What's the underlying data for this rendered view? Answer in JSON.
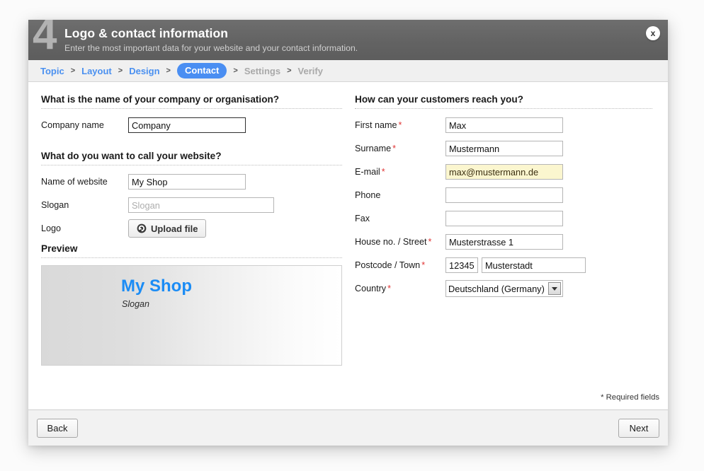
{
  "header": {
    "step": "4",
    "title": "Logo & contact information",
    "subtitle": "Enter the most important data for your website and your contact information.",
    "close_label": "x"
  },
  "breadcrumb": {
    "separator": ">",
    "items": [
      {
        "label": "Topic",
        "state": "link"
      },
      {
        "label": "Layout",
        "state": "link"
      },
      {
        "label": "Design",
        "state": "link"
      },
      {
        "label": "Contact",
        "state": "active"
      },
      {
        "label": "Settings",
        "state": "muted"
      },
      {
        "label": "Verify",
        "state": "muted"
      }
    ]
  },
  "left": {
    "company_section": {
      "title": "What is the name of your company or organisation?",
      "company_name_label": "Company name",
      "company_name_value": "Company"
    },
    "website_section": {
      "title": "What do you want to call your website?",
      "site_name_label": "Name of website",
      "site_name_value": "My Shop",
      "slogan_label": "Slogan",
      "slogan_value": "",
      "slogan_placeholder": "Slogan",
      "logo_label": "Logo",
      "upload_label": "Upload file",
      "upload_icon": "upload-circle-icon"
    },
    "preview": {
      "title": "Preview",
      "site_title": "My Shop",
      "slogan": "Slogan"
    }
  },
  "right": {
    "title": "How can your customers reach you?",
    "required_marker": "*",
    "fields": [
      {
        "label": "First name",
        "required": true,
        "value": "Max",
        "style": "normal"
      },
      {
        "label": "Surname",
        "required": true,
        "value": "Mustermann",
        "style": "normal"
      },
      {
        "label": "E-mail",
        "required": true,
        "value": "max@mustermann.de",
        "style": "autofill"
      },
      {
        "label": "Phone",
        "required": false,
        "value": "",
        "style": "normal"
      },
      {
        "label": "Fax",
        "required": false,
        "value": "",
        "style": "normal"
      },
      {
        "label": "House no. / Street",
        "required": true,
        "value": "Musterstrasse 1",
        "style": "normal"
      }
    ],
    "postcode_label": "Postcode / Town",
    "postcode_value": "12345",
    "town_value": "Musterstadt",
    "country_label": "Country",
    "country_value": "Deutschland (Germany)",
    "country_arrow_icon": "chevron-down-icon"
  },
  "required_note": "* Required fields",
  "footer": {
    "back_label": "Back",
    "next_label": "Next"
  },
  "colors": {
    "accent_blue": "#4a8ef2",
    "link_blue": "#4a90f0",
    "preview_title": "#1b8cf5",
    "required_red": "#e03232",
    "header_gray": "#636363",
    "autofill_yellow": "#fbf6cf"
  }
}
